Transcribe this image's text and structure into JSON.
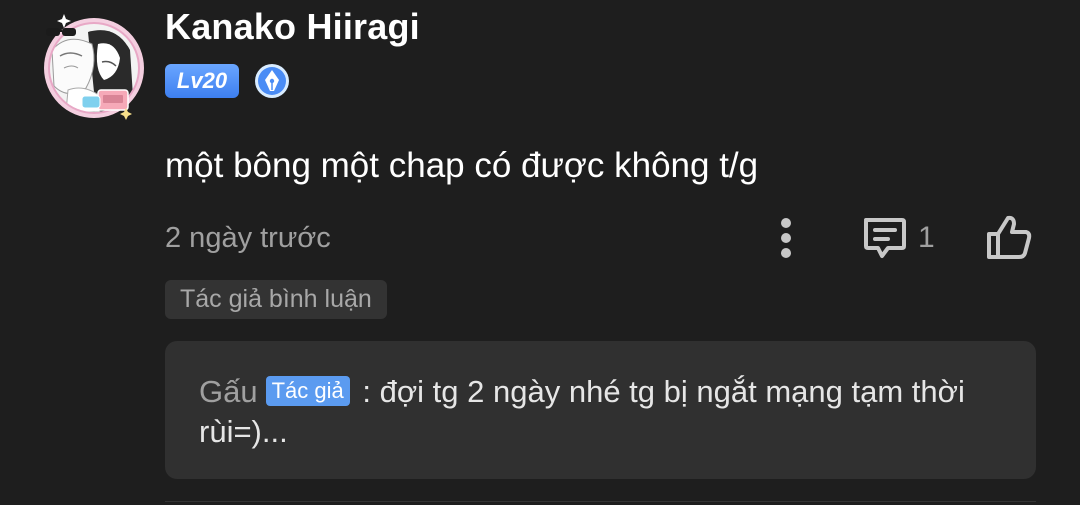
{
  "user": {
    "name": "Kanako Hiiragi",
    "level": "Lv20",
    "avatar_icon": "anime-avatar-icon",
    "badge_icon": "pen-nib-icon"
  },
  "comment": {
    "text": "một bông một chap có được không t/g",
    "timestamp": "2 ngày trước",
    "reply_count": "1",
    "author_comment_tag": "Tác giả bình luận"
  },
  "actions": {
    "more_icon": "more-vertical-icon",
    "reply_icon": "comment-icon",
    "like_icon": "thumbs-up-icon"
  },
  "reply": {
    "name": "Gấu",
    "tag": "Tác giả",
    "separator": " : ",
    "text": "đợi tg 2 ngày nhé tg bị ngắt mạng tạm thời rùi=)..."
  },
  "colors": {
    "background": "#1e1e1e",
    "badge_blue": "#4a8cf5",
    "muted_text": "#a0a0a0",
    "reply_box": "#303030",
    "tag_background": "#333333"
  }
}
